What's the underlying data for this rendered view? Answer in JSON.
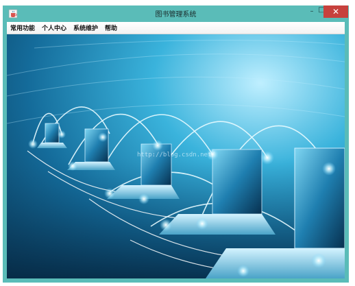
{
  "window": {
    "title": "图书管理系统",
    "icon": "java-cup-icon",
    "controls": {
      "minimize": "–",
      "maximize": "□",
      "close": "✕"
    },
    "colors": {
      "frame": "#5abcb8",
      "close_button": "#c7413d"
    }
  },
  "menubar": {
    "items": [
      {
        "label": "常用功能"
      },
      {
        "label": "个人中心"
      },
      {
        "label": "系统维护"
      },
      {
        "label": "帮助"
      }
    ]
  },
  "content": {
    "background_image": "networked-laptops-image",
    "watermark": "http://blog.csdn.net/"
  }
}
